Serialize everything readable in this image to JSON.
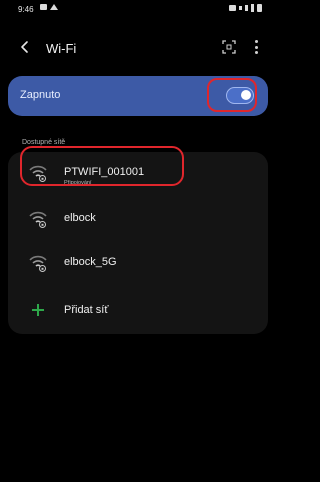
{
  "status_bar": {
    "time": "9:46"
  },
  "header": {
    "title": "Wi-Fi"
  },
  "wifi_toggle": {
    "label": "Zapnuto",
    "state": "on",
    "accent_color": "#3d5aa6"
  },
  "networks": {
    "section_label": "Dostupné sítě",
    "items": [
      {
        "name": "PTWIFI_001001",
        "status": "Připojování",
        "icon": "wifi-icon"
      },
      {
        "name": "elbock",
        "status": "",
        "icon": "wifi-icon"
      },
      {
        "name": "elbock_5G",
        "status": "",
        "icon": "wifi-icon"
      }
    ],
    "add_label": "Přidat síť"
  },
  "highlight_color": "#e0262c"
}
